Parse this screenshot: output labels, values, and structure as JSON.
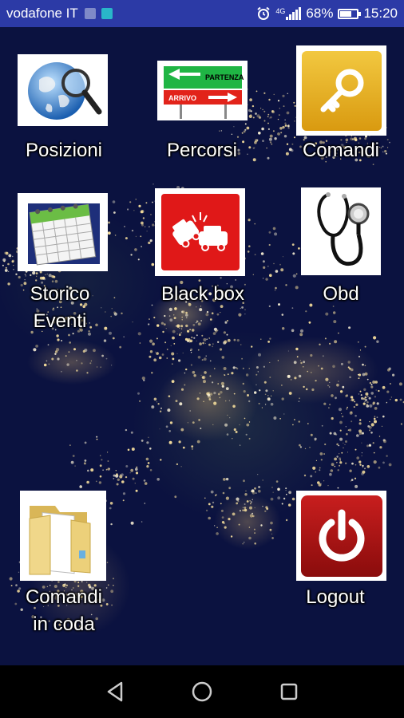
{
  "status_bar": {
    "carrier": "vodafone IT",
    "network": "4G",
    "battery_percent": "68%",
    "time": "15:20",
    "bg_color": "#2c3aa6"
  },
  "apps": [
    {
      "key": "posizioni",
      "lines": [
        "Posizioni"
      ],
      "icon": "globe-magnifier-icon"
    },
    {
      "key": "percorsi",
      "lines": [
        "Percorsi"
      ],
      "icon": "route-sign-icon",
      "sign_top": "PARTENZA",
      "sign_bottom": "ARRIVO"
    },
    {
      "key": "comandi",
      "lines": [
        "Comandi"
      ],
      "icon": "key-icon"
    },
    {
      "key": "storico-eventi",
      "lines": [
        "Storico",
        "Eventi"
      ],
      "icon": "calendar-icon"
    },
    {
      "key": "black-box",
      "lines": [
        "Black box"
      ],
      "icon": "car-crash-icon"
    },
    {
      "key": "obd",
      "lines": [
        "Obd"
      ],
      "icon": "stethoscope-icon"
    },
    {
      "key": "comandi-in-coda",
      "lines": [
        "Comandi",
        "in coda"
      ],
      "icon": "folder-icon"
    },
    {
      "key": "logout",
      "lines": [
        "Logout"
      ],
      "icon": "power-icon"
    }
  ],
  "colors": {
    "key_tile": "#e6b020",
    "power_tile": "#a01010",
    "crash_tile": "#e01818"
  }
}
